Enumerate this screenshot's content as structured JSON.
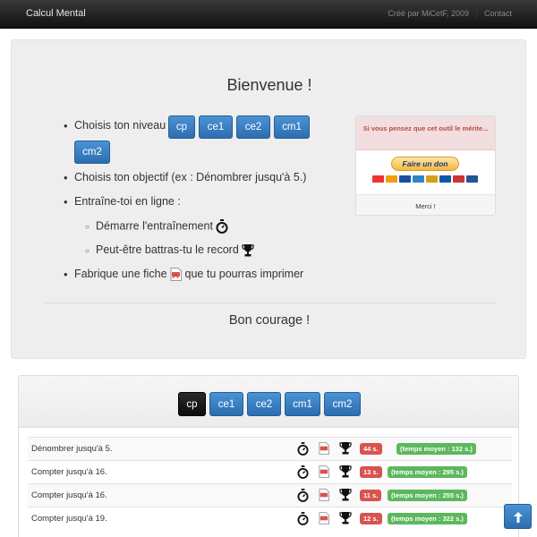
{
  "navbar": {
    "brand": "Calcul Mental",
    "credit": "Créé par MiCetF, 2009",
    "contact": "Contact"
  },
  "hero": {
    "title": "Bienvenue !",
    "level_label": "Choisis ton niveau :",
    "levels": [
      "cp",
      "ce1",
      "ce2",
      "cm1",
      "cm2"
    ],
    "objective": "Choisis ton objectif (ex : Dénombrer jusqu'à 5.)",
    "train_online": "Entraîne-toi en ligne :",
    "start_training": "Démarre l'entraînement",
    "beat_record": "Peut-être battras-tu le record",
    "make_sheet_pre": "Fabrique une fiche",
    "make_sheet_post": "que tu pourras imprimer",
    "footer": "Bon courage !"
  },
  "donate": {
    "heading": "Si vous pensez que cet outil le mérite...",
    "button": "Faire un don",
    "thanks": "Merci !"
  },
  "panel": {
    "tabs": [
      "cp",
      "ce1",
      "ce2",
      "cm1",
      "cm2"
    ],
    "active_tab": "cp",
    "rows": [
      {
        "label": "Dénombrer jusqu'à 5.",
        "record": "44 s.",
        "average": "(temps moyen : 132 s.)"
      },
      {
        "label": "Compter jusqu'à 16.",
        "record": "13 s.",
        "average": "(temps moyen : 295 s.)"
      },
      {
        "label": "Compter jusqu'à 16.",
        "record": "11 s.",
        "average": "(temps moyen : 255 s.)"
      },
      {
        "label": "Compter jusqu'à 19.",
        "record": "12 s.",
        "average": "(temps moyen : 322 s.)"
      }
    ]
  },
  "colors": {
    "primary": "#337ab7",
    "danger": "#d9534f",
    "success": "#5cb85c",
    "navbar": "#222222"
  },
  "icons": [
    "stopwatch-icon",
    "trophy-icon",
    "pdf-icon",
    "arrow-up-icon"
  ]
}
